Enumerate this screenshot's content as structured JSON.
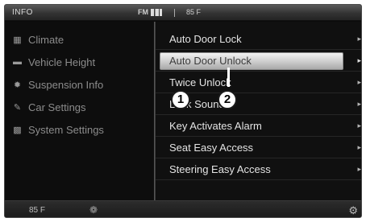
{
  "statusbar": {
    "title": "INFO",
    "radio_label": "FM",
    "temperature": "85 F"
  },
  "sidebar": {
    "items": [
      {
        "label": "Climate",
        "icon": "climate-icon"
      },
      {
        "label": "Vehicle Height",
        "icon": "vehicle-icon"
      },
      {
        "label": "Suspension Info",
        "icon": "suspension-icon"
      },
      {
        "label": "Car Settings",
        "icon": "car-settings-icon"
      },
      {
        "label": "System Settings",
        "icon": "system-settings-icon"
      }
    ]
  },
  "menu": {
    "items": [
      {
        "label": "Auto Door Lock"
      },
      {
        "label": "Auto Door Unlock",
        "selected": true
      },
      {
        "label": "Twice Unlock"
      },
      {
        "label": "Lock Sound"
      },
      {
        "label": "Key Activates Alarm"
      },
      {
        "label": "Seat Easy Access"
      },
      {
        "label": "Steering Easy Access"
      }
    ]
  },
  "callouts": [
    "1",
    "2"
  ],
  "bottombar": {
    "temperature": "85 F"
  }
}
